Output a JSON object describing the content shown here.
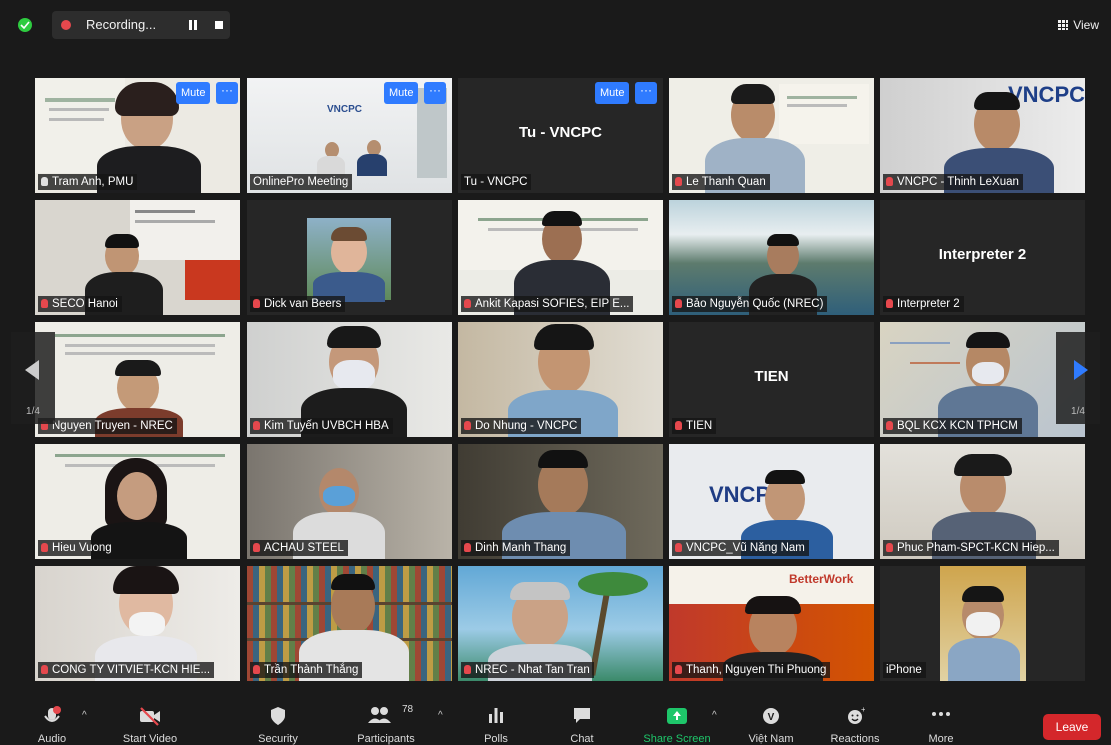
{
  "recording": {
    "label": "Recording..."
  },
  "view_button": {
    "label": "View"
  },
  "buttons": {
    "mute": "Mute",
    "more": "···"
  },
  "pager": {
    "left_label": "1/4",
    "right_label": "1/4"
  },
  "tiles": [
    {
      "name": "Tram Anh, PMU",
      "show_mute": true,
      "active": true
    },
    {
      "name": "OnlinePro Meeting",
      "show_mute": true
    },
    {
      "name": "Tu - VNCPC",
      "big_name": "Tu - VNCPC",
      "show_mute": true
    },
    {
      "name": "Le Thanh Quan"
    },
    {
      "name": "VNCPC - Thinh LeXuan"
    },
    {
      "name": "SECO Hanoi"
    },
    {
      "name": "Dick van Beers"
    },
    {
      "name": "Ankit Kapasi SOFIES, EIP E..."
    },
    {
      "name": "Bảo Nguyễn Quốc (NREC)"
    },
    {
      "name": "Interpreter 2",
      "big_name": "Interpreter 2"
    },
    {
      "name": "Nguyen Truyen - NREC"
    },
    {
      "name": "Kim Tuyến UVBCH HBA"
    },
    {
      "name": "Do Nhung - VNCPC"
    },
    {
      "name": "TIEN",
      "big_name": "TIEN"
    },
    {
      "name": "BQL KCX KCN TPHCM"
    },
    {
      "name": "Hieu Vuong"
    },
    {
      "name": "ACHAU STEEL"
    },
    {
      "name": "Dinh Manh Thang"
    },
    {
      "name": "VNCPC_Vũ Năng Nam"
    },
    {
      "name": "Phuc Pham-SPCT-KCN Hiep..."
    },
    {
      "name": "CONG TY VITVIET-KCN HIE..."
    },
    {
      "name": "Trần Thành Thắng"
    },
    {
      "name": "NREC - Nhat Tan Tran"
    },
    {
      "name": "Thanh, Nguyen Thi Phuong"
    },
    {
      "name": "iPhone"
    }
  ],
  "logos": {
    "vncpc": "VNCPC",
    "betterwork": "BetterWork"
  },
  "toolbar": {
    "audio": "Audio",
    "start_video": "Start Video",
    "security": "Security",
    "participants": "Participants",
    "participants_count": "78",
    "polls": "Polls",
    "chat": "Chat",
    "share_screen": "Share Screen",
    "language": "Việt Nam",
    "reactions": "Reactions",
    "more": "More",
    "leave": "Leave"
  },
  "colors": {
    "accent_blue": "#2f7bff",
    "active_border": "#c8e026",
    "share_green": "#1ec66a",
    "leave_red": "#d4272b"
  }
}
